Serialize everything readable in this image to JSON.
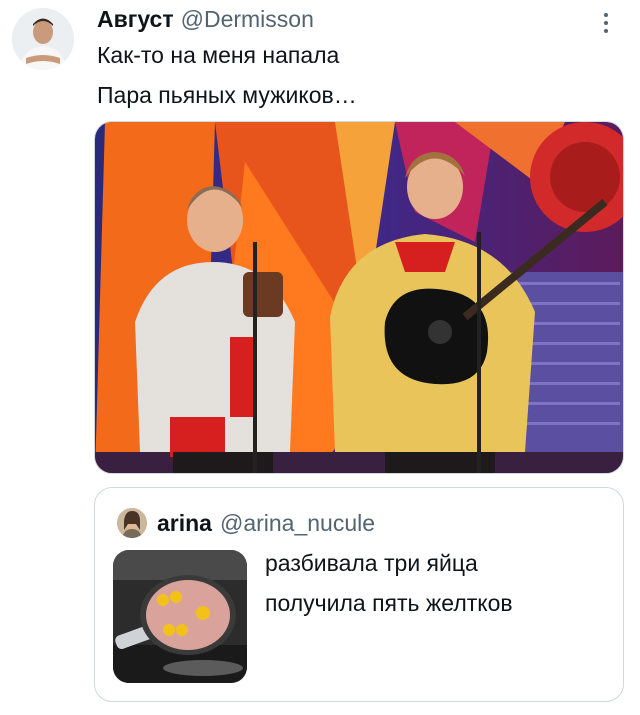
{
  "tweet": {
    "author": {
      "display_name": "Август",
      "handle": "@Dermisson",
      "avatar_icon": "user-avatar"
    },
    "text_lines": [
      "Как-то на меня напала",
      "Пара пьяных мужиков…"
    ],
    "more_icon": "three-dots-vertical-icon",
    "media_alt_icon": "photo-two-singers"
  },
  "quoted_tweet": {
    "author": {
      "display_name": "arina",
      "handle": "@arina_nucule",
      "avatar_icon": "user-avatar"
    },
    "text_lines": [
      "разбивала три яйца",
      "получила пять желтков"
    ],
    "media_alt_icon": "photo-frying-pan-eggs"
  },
  "colors": {
    "text_primary": "#0f1419",
    "text_secondary": "#536471",
    "border": "#cfd9de"
  }
}
